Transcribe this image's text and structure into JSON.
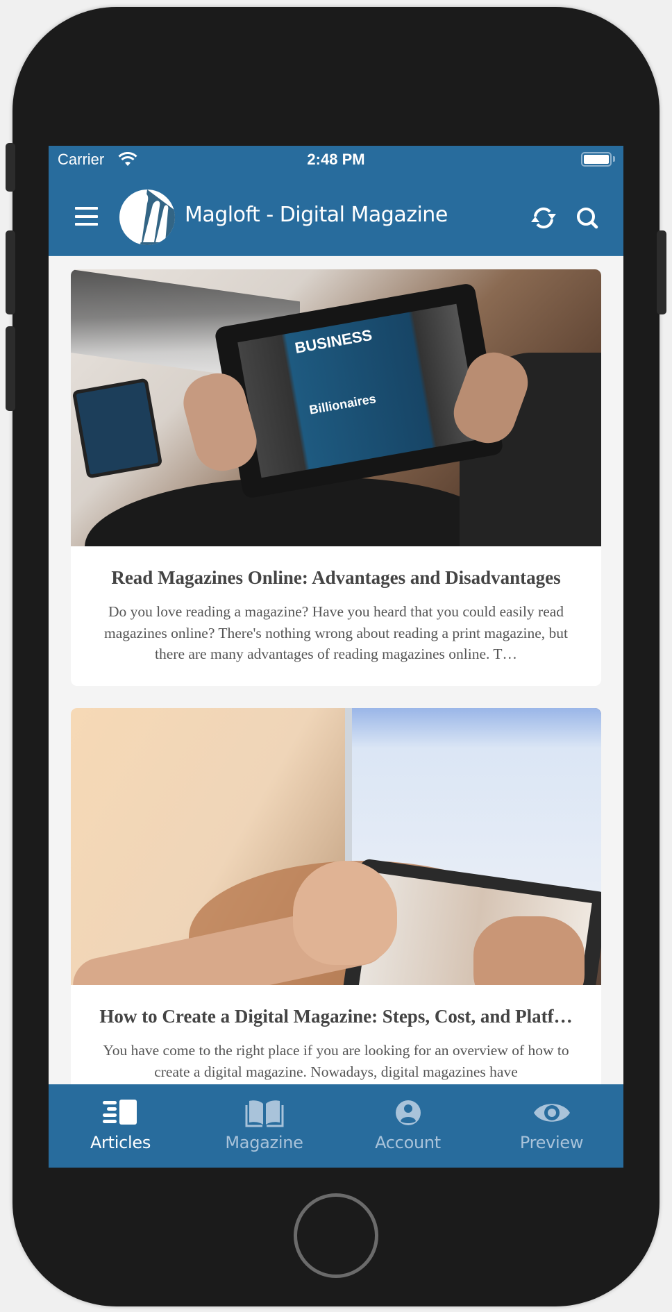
{
  "status_bar": {
    "carrier": "Carrier",
    "time": "2:48 PM",
    "wifi_icon": "wifi-icon",
    "battery_icon": "battery-icon"
  },
  "header": {
    "title": "Magloft - Digital Magazine",
    "menu_icon": "hamburger-menu-icon",
    "logo": "magloft-logo",
    "refresh_icon": "refresh-icon",
    "search_icon": "search-icon"
  },
  "colors": {
    "brand": "#286c9d",
    "tab_active": "#ffffff",
    "tab_inactive": "#a9c3da",
    "card_background": "#ffffff",
    "content_background": "#f4f4f4",
    "title_text": "#444444",
    "body_text": "#555555"
  },
  "articles": [
    {
      "title": "Read Magazines Online: Advantages and Disadvantages",
      "excerpt": "Do you love reading a magazine? Have you heard that you could easily read magazines online? There's nothing wrong about reading a print magazine, but there are many advantages of reading magazines online. T…",
      "image_alt": "Hands holding a tablet showing a Business magazine cover"
    },
    {
      "title": "How to Create a Digital Magazine: Steps, Cost, and Platf…",
      "excerpt": "You have come to the right place if you are looking for an overview of how to create a digital magazine. Nowadays, digital magazines have",
      "image_alt": "Hands using a tablet in front of a laptop"
    }
  ],
  "tabs": [
    {
      "label": "Articles",
      "icon": "articles-icon",
      "active": true
    },
    {
      "label": "Magazine",
      "icon": "book-icon",
      "active": false
    },
    {
      "label": "Account",
      "icon": "account-icon",
      "active": false
    },
    {
      "label": "Preview",
      "icon": "eye-icon",
      "active": false
    }
  ]
}
